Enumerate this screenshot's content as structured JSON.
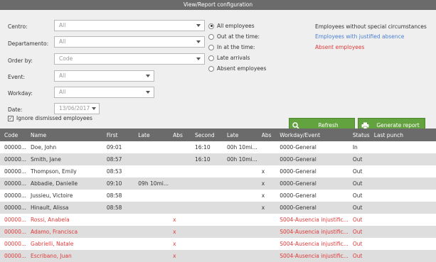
{
  "title": "View/Report configuration",
  "filters": {
    "centro": {
      "label": "Centro:",
      "value": "All"
    },
    "departamento": {
      "label": "Departamento:",
      "value": "All"
    },
    "order_by": {
      "label": "Order by:",
      "value": "Code"
    },
    "event": {
      "label": "Event:",
      "value": "All"
    },
    "workday": {
      "label": "Workday:",
      "value": "All"
    },
    "date": {
      "label": "Date:",
      "value": "13/06/2017"
    }
  },
  "radios": [
    {
      "label": "All employees",
      "checked": true
    },
    {
      "label": "Out at the time:",
      "checked": false
    },
    {
      "label": "In at the time:",
      "checked": false
    },
    {
      "label": "Late arrivals",
      "checked": false
    },
    {
      "label": "Absent employees",
      "checked": false
    }
  ],
  "legend": {
    "normal": {
      "label": "Employees without special circumstances",
      "color": "#333333"
    },
    "justified": {
      "label": "Employees with justified absence",
      "color": "#4a7fd6"
    },
    "absent": {
      "label": "Absent employees",
      "color": "#e03a3a"
    }
  },
  "ignore_dismissed": {
    "label": "Ignore dismissed employees",
    "checked": true
  },
  "buttons": {
    "refresh": "Refresh",
    "generate": "Generate report"
  },
  "table": {
    "columns": [
      "Code",
      "Name",
      "First",
      "Late",
      "Abs",
      "Second",
      "Late",
      "Abs",
      "Workday/Event",
      "Status",
      "Last punch"
    ],
    "rows": [
      {
        "code": "00000...",
        "name": "Doe, John",
        "first": "09:01",
        "late1": "",
        "abs1": "",
        "second": "16:10",
        "late2": "00h 10mi...",
        "abs2": "",
        "workday": "0000-General",
        "status": "In",
        "last": "",
        "absent": false
      },
      {
        "code": "00000...",
        "name": "Smith, Jane",
        "first": "08:57",
        "late1": "",
        "abs1": "",
        "second": "16:10",
        "late2": "00h 10mi...",
        "abs2": "",
        "workday": "0000-General",
        "status": "Out",
        "last": "",
        "absent": false
      },
      {
        "code": "00000...",
        "name": "Thompson, Emily",
        "first": "08:53",
        "late1": "",
        "abs1": "",
        "second": "",
        "late2": "",
        "abs2": "x",
        "workday": "0000-General",
        "status": "Out",
        "last": "",
        "absent": false
      },
      {
        "code": "00000...",
        "name": "Abbadie, Danielle",
        "first": "09:10",
        "late1": "09h 10mi...",
        "abs1": "",
        "second": "",
        "late2": "",
        "abs2": "x",
        "workday": "0000-General",
        "status": "Out",
        "last": "",
        "absent": false
      },
      {
        "code": "00000...",
        "name": "Jussieu, Victoire",
        "first": "08:58",
        "late1": "",
        "abs1": "",
        "second": "",
        "late2": "",
        "abs2": "x",
        "workday": "0000-General",
        "status": "Out",
        "last": "",
        "absent": false
      },
      {
        "code": "00000...",
        "name": "Hinault, Alissa",
        "first": "08:58",
        "late1": "",
        "abs1": "",
        "second": "",
        "late2": "",
        "abs2": "x",
        "workday": "0000-General",
        "status": "Out",
        "last": "",
        "absent": false
      },
      {
        "code": "00000...",
        "name": "Rossi, Anabela",
        "first": "",
        "late1": "",
        "abs1": "x",
        "second": "",
        "late2": "",
        "abs2": "",
        "workday": "S004-Ausencia injustific...",
        "status": "Out",
        "last": "",
        "absent": true
      },
      {
        "code": "00000...",
        "name": "Adamo, Francisca",
        "first": "",
        "late1": "",
        "abs1": "x",
        "second": "",
        "late2": "",
        "abs2": "",
        "workday": "S004-Ausencia injustific...",
        "status": "Out",
        "last": "",
        "absent": true
      },
      {
        "code": "00000...",
        "name": "Gabrielli, Natale",
        "first": "",
        "late1": "",
        "abs1": "x",
        "second": "",
        "late2": "",
        "abs2": "",
        "workday": "S004-Ausencia injustific...",
        "status": "Out",
        "last": "",
        "absent": true
      },
      {
        "code": "00000...",
        "name": "Escribano, Juan",
        "first": "",
        "late1": "",
        "abs1": "x",
        "second": "",
        "late2": "",
        "abs2": "",
        "workday": "S004-Ausencia injustific...",
        "status": "Out",
        "last": "",
        "absent": true
      }
    ]
  }
}
